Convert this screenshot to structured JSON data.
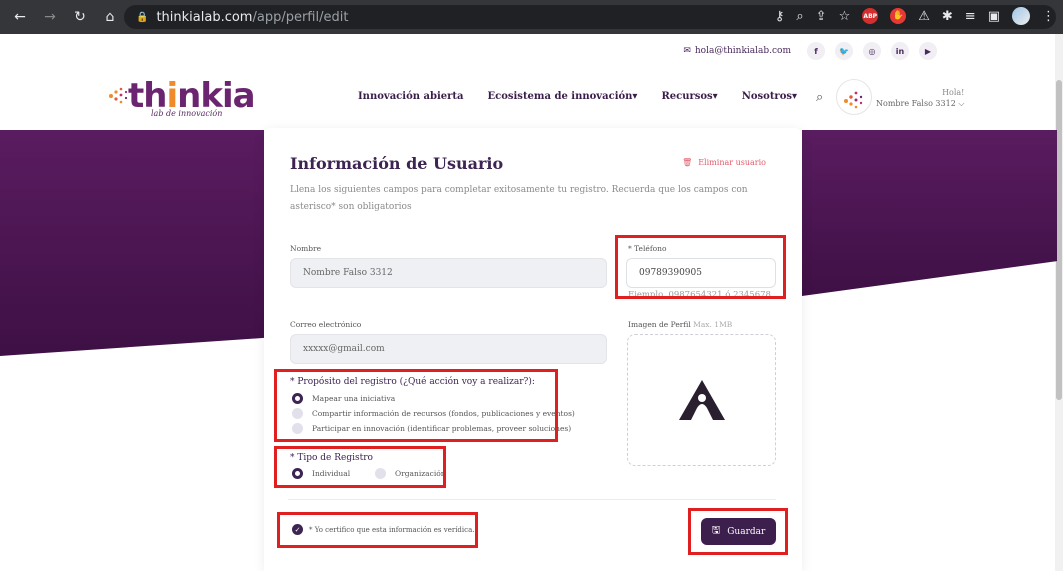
{
  "browser": {
    "url_host": "thinkialab.com",
    "url_path": "/app/perfil/edit",
    "abp_label": "ABP"
  },
  "topbar": {
    "email": "hola@thinkialab.com",
    "socials": [
      "f",
      "t",
      "ig",
      "in",
      "yt"
    ]
  },
  "logo": {
    "word_main": "th",
    "word_accent": "i",
    "word_end": "nkia",
    "tagline": "lab de innovación"
  },
  "nav": {
    "items": [
      "Innovación abierta",
      "Ecosistema de innovación▾",
      "Recursos▾",
      "Nosotros▾"
    ]
  },
  "user": {
    "greeting": "Hola!",
    "name": "Nombre Falso 3312 ⌵"
  },
  "form": {
    "title": "Información de Usuario",
    "delete_label": "Eliminar usuario",
    "description": "Llena los siguientes campos para completar exitosamente tu registro. Recuerda que los campos con asterisco* son obligatorios",
    "name_label": "Nombre",
    "name_value": "Nombre Falso 3312",
    "phone_label": "* Teléfono",
    "phone_value": "09789390905",
    "phone_hint": "Ejemplo. 0987654321 ó 2345678",
    "email_label": "Correo electrónico",
    "email_value": "xxxxx@gmail.com",
    "image_label": "Imagen de Perfil",
    "image_hint": "Max. 1MB",
    "purpose_title": "* Propósito del registro (¿Qué acción voy a realizar?):",
    "purpose_options": [
      "Mapear una iniciativa",
      "Compartir información de recursos (fondos, publicaciones y eventos)",
      "Participar en innovación (identificar problemas, proveer soluciones)"
    ],
    "type_title": "* Tipo de Registro",
    "type_options": [
      "Individual",
      "Organización"
    ],
    "certify_label": "* Yo certifico que esta información es verídica.",
    "save_label": "Guardar"
  },
  "colors": {
    "brand_purple": "#3d2452",
    "accent_orange": "#f08a2a",
    "highlight_red": "#e02020"
  }
}
